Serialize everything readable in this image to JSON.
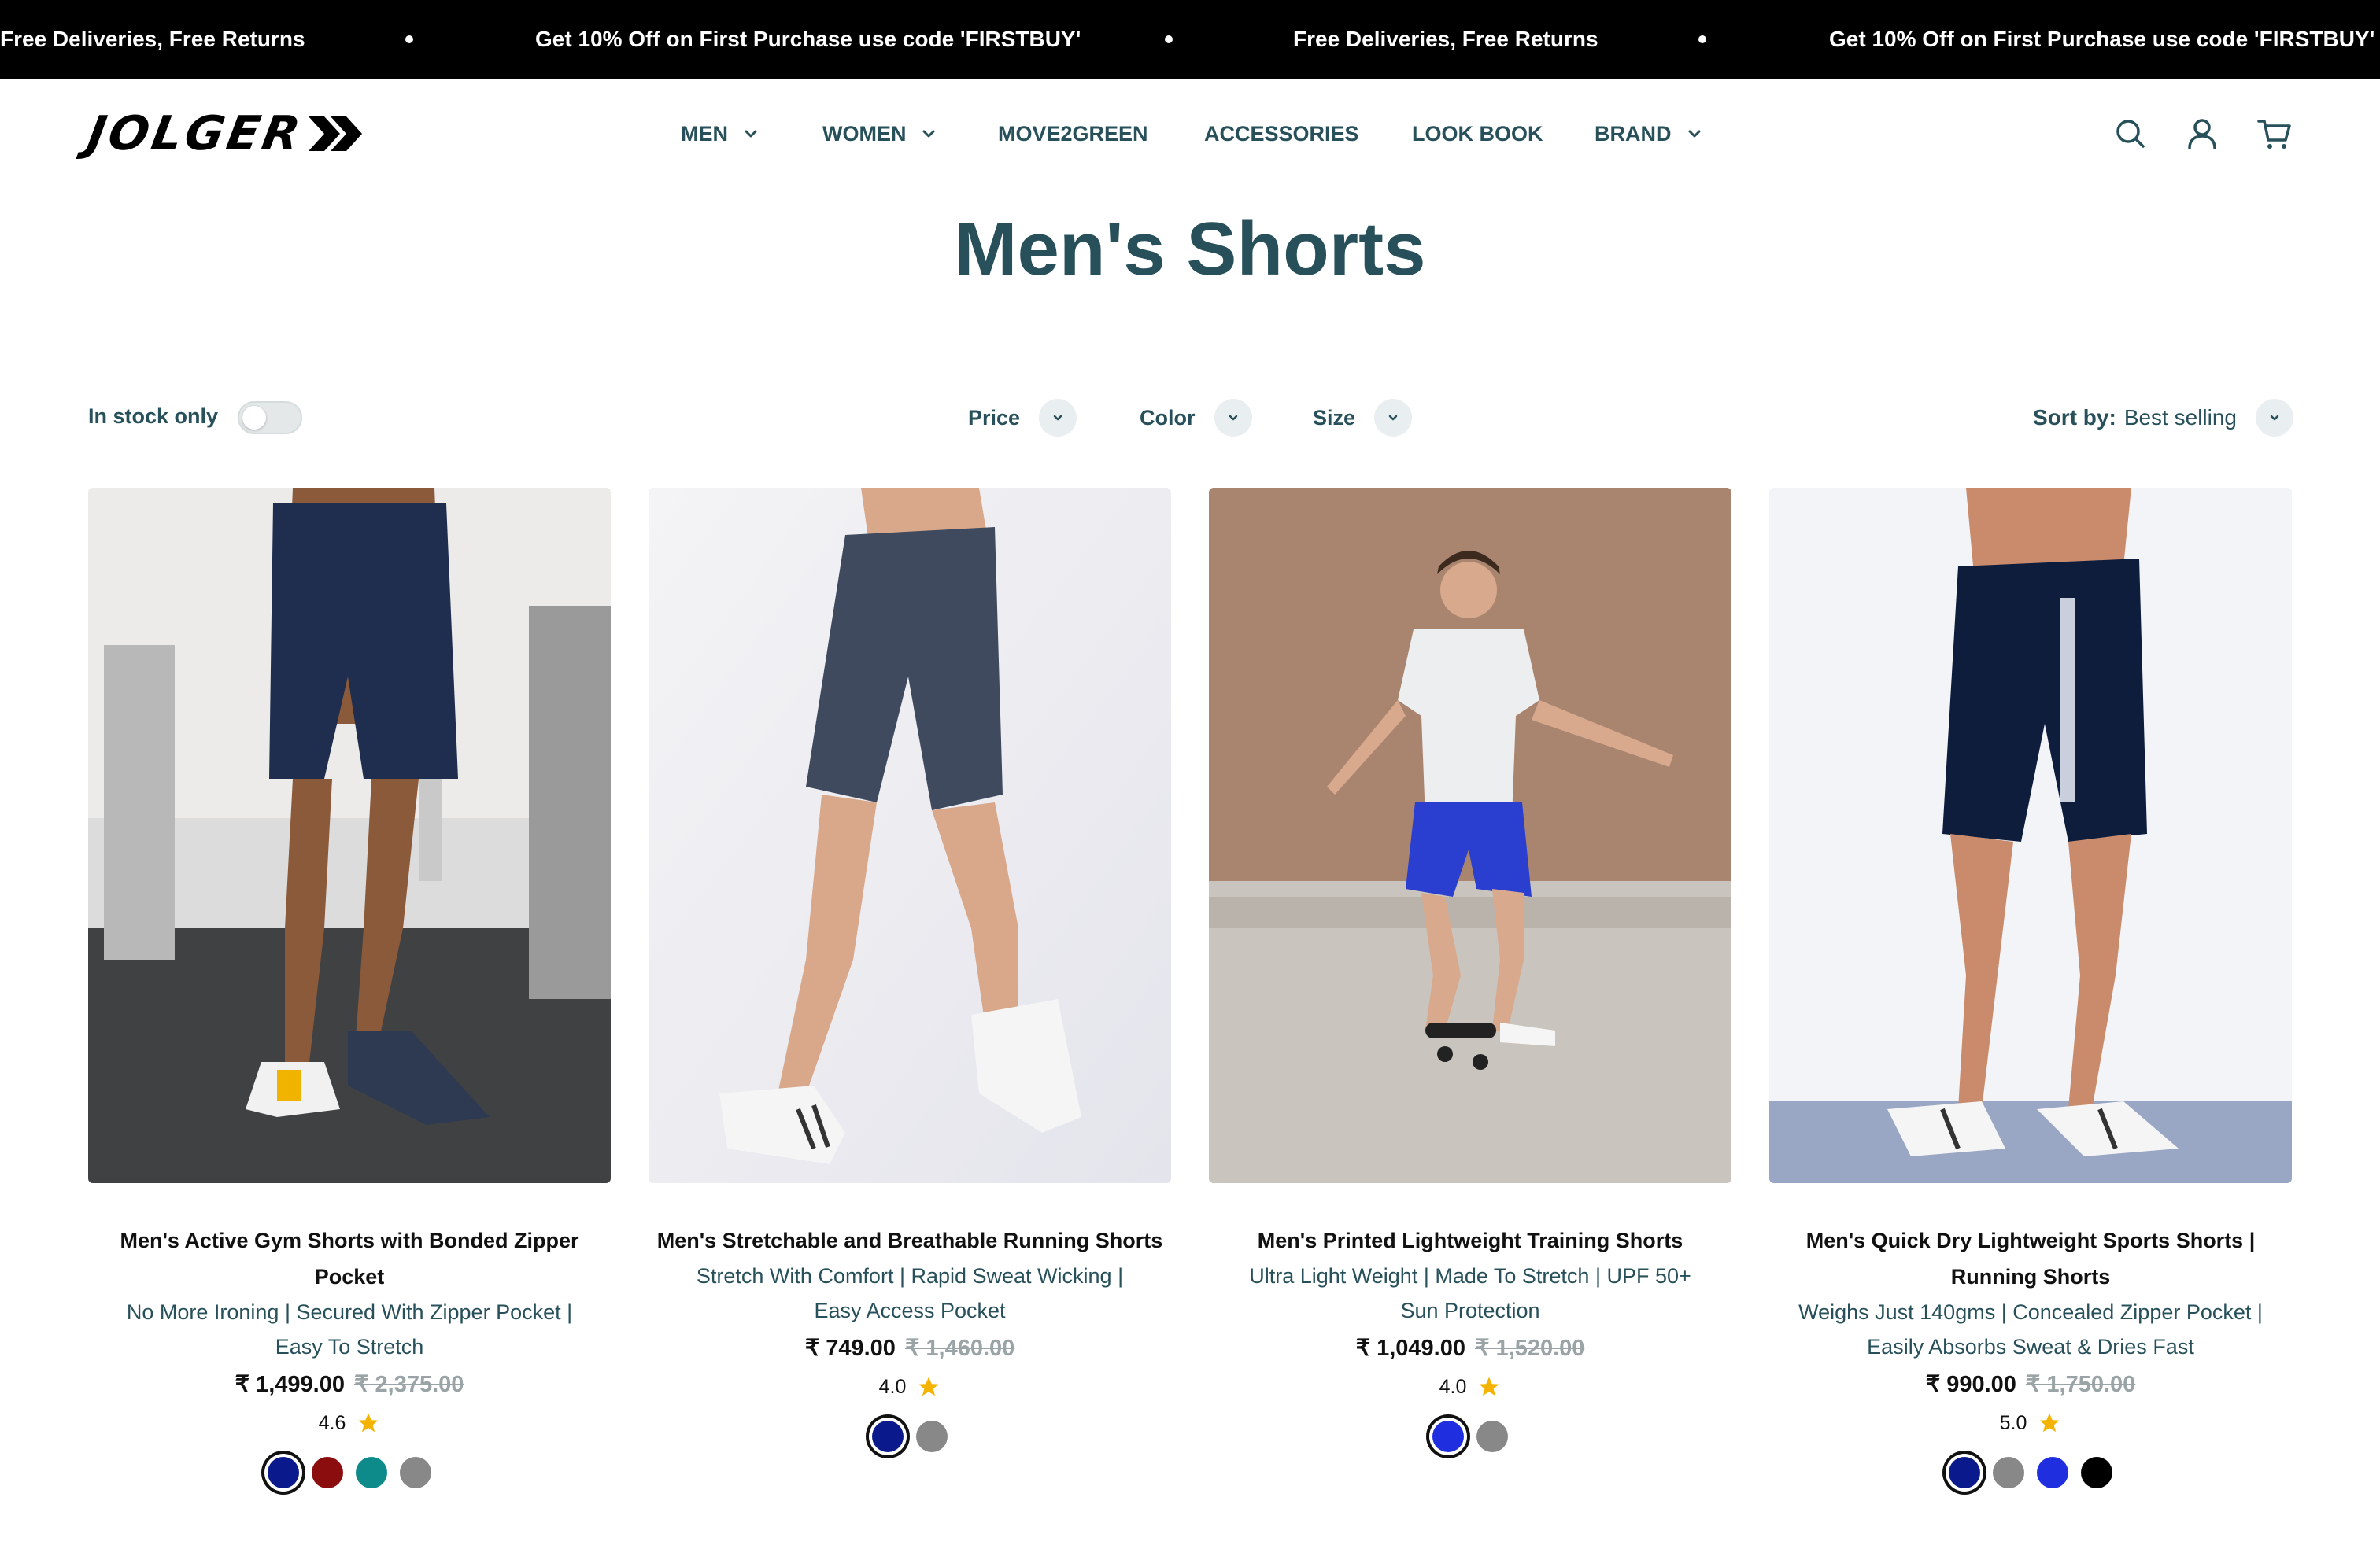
{
  "announcement": {
    "messages": [
      "Free Deliveries, Free Returns",
      "Get 10% Off on First Purchase use code 'FIRSTBUY'",
      "Free Deliveries, Free Returns",
      "Get 10% Off on First Purchase use code 'FIRSTBUY'"
    ]
  },
  "brand": {
    "logo_text": "JOLGER"
  },
  "nav": {
    "items": [
      {
        "label": "MEN",
        "dropdown": true
      },
      {
        "label": "WOMEN",
        "dropdown": true
      },
      {
        "label": "MOVE2GREEN",
        "dropdown": false
      },
      {
        "label": "ACCESSORIES",
        "dropdown": false
      },
      {
        "label": "LOOK BOOK",
        "dropdown": false
      },
      {
        "label": "BRAND",
        "dropdown": true
      }
    ],
    "icons": [
      "search-icon",
      "account-icon",
      "cart-icon"
    ]
  },
  "page": {
    "title": "Men's Shorts"
  },
  "filters": {
    "in_stock_label": "In stock only",
    "in_stock_on": false,
    "items": [
      "Price",
      "Color",
      "Size"
    ],
    "sort_label": "Sort by:",
    "sort_value": "Best selling"
  },
  "colors": {
    "text_primary": "#27505a",
    "announcement_bg": "#000000",
    "star": "#f5b301"
  },
  "products": [
    {
      "name": "Men's Active Gym Shorts with Bonded Zipper Pocket",
      "description": "No More Ironing | Secured With Zipper Pocket | Easy To Stretch",
      "price": "₹ 1,499.00",
      "compare_price": "₹ 2,375.00",
      "rating": "4.6",
      "swatches": [
        "#0a1a8c",
        "#8b0d0d",
        "#0d8b8b",
        "#888888"
      ],
      "selected_swatch": 0
    },
    {
      "name": "Men's Stretchable and Breathable Running Shorts",
      "description": "Stretch With Comfort | Rapid Sweat Wicking | Easy Access Pocket",
      "price": "₹ 749.00",
      "compare_price": "₹ 1,460.00",
      "rating": "4.0",
      "swatches": [
        "#0a1a8c",
        "#888888"
      ],
      "selected_swatch": 0
    },
    {
      "name": "Men's Printed Lightweight Training Shorts",
      "description": "Ultra Light Weight | Made To Stretch | UPF 50+ Sun Protection",
      "price": "₹ 1,049.00",
      "compare_price": "₹ 1,520.00",
      "rating": "4.0",
      "swatches": [
        "#1f2fe0",
        "#888888"
      ],
      "selected_swatch": 0
    },
    {
      "name": "Men's Quick Dry Lightweight Sports Shorts | Running Shorts",
      "description": "Weighs Just 140gms | Concealed Zipper Pocket | Easily Absorbs Sweat & Dries Fast",
      "price": "₹ 990.00",
      "compare_price": "₹ 1,750.00",
      "rating": "5.0",
      "swatches": [
        "#0a1a8c",
        "#888888",
        "#1f2fe0",
        "#000000"
      ],
      "selected_swatch": 0
    }
  ]
}
